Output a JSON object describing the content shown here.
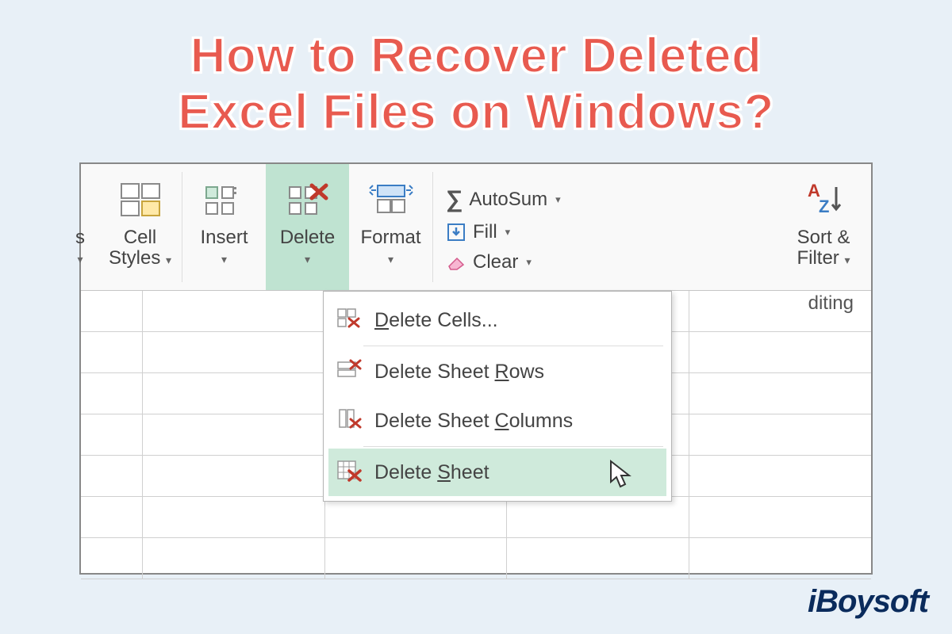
{
  "title_line1": "How to Recover Deleted",
  "title_line2": "Excel Files on Windows?",
  "ribbon": {
    "cell_styles_l1": "Cell",
    "cell_styles_l2": "Styles",
    "insert": "Insert",
    "delete": "Delete",
    "format": "Format",
    "autosum": "AutoSum",
    "fill": "Fill",
    "clear": "Clear",
    "sort_l1": "Sort &",
    "sort_l2": "Filter",
    "editing_group": "diting",
    "edge_label": "s"
  },
  "menu": {
    "delete_cells": "elete Cells...",
    "delete_cells_u": "D",
    "delete_rows_pre": "Delete Sheet ",
    "delete_rows_u": "R",
    "delete_rows_post": "ows",
    "delete_cols_pre": "Delete Sheet ",
    "delete_cols_u": "C",
    "delete_cols_post": "olumns",
    "delete_sheet_pre": "Delete ",
    "delete_sheet_u": "S",
    "delete_sheet_post": "heet"
  },
  "logo_text": "iBoysoft"
}
